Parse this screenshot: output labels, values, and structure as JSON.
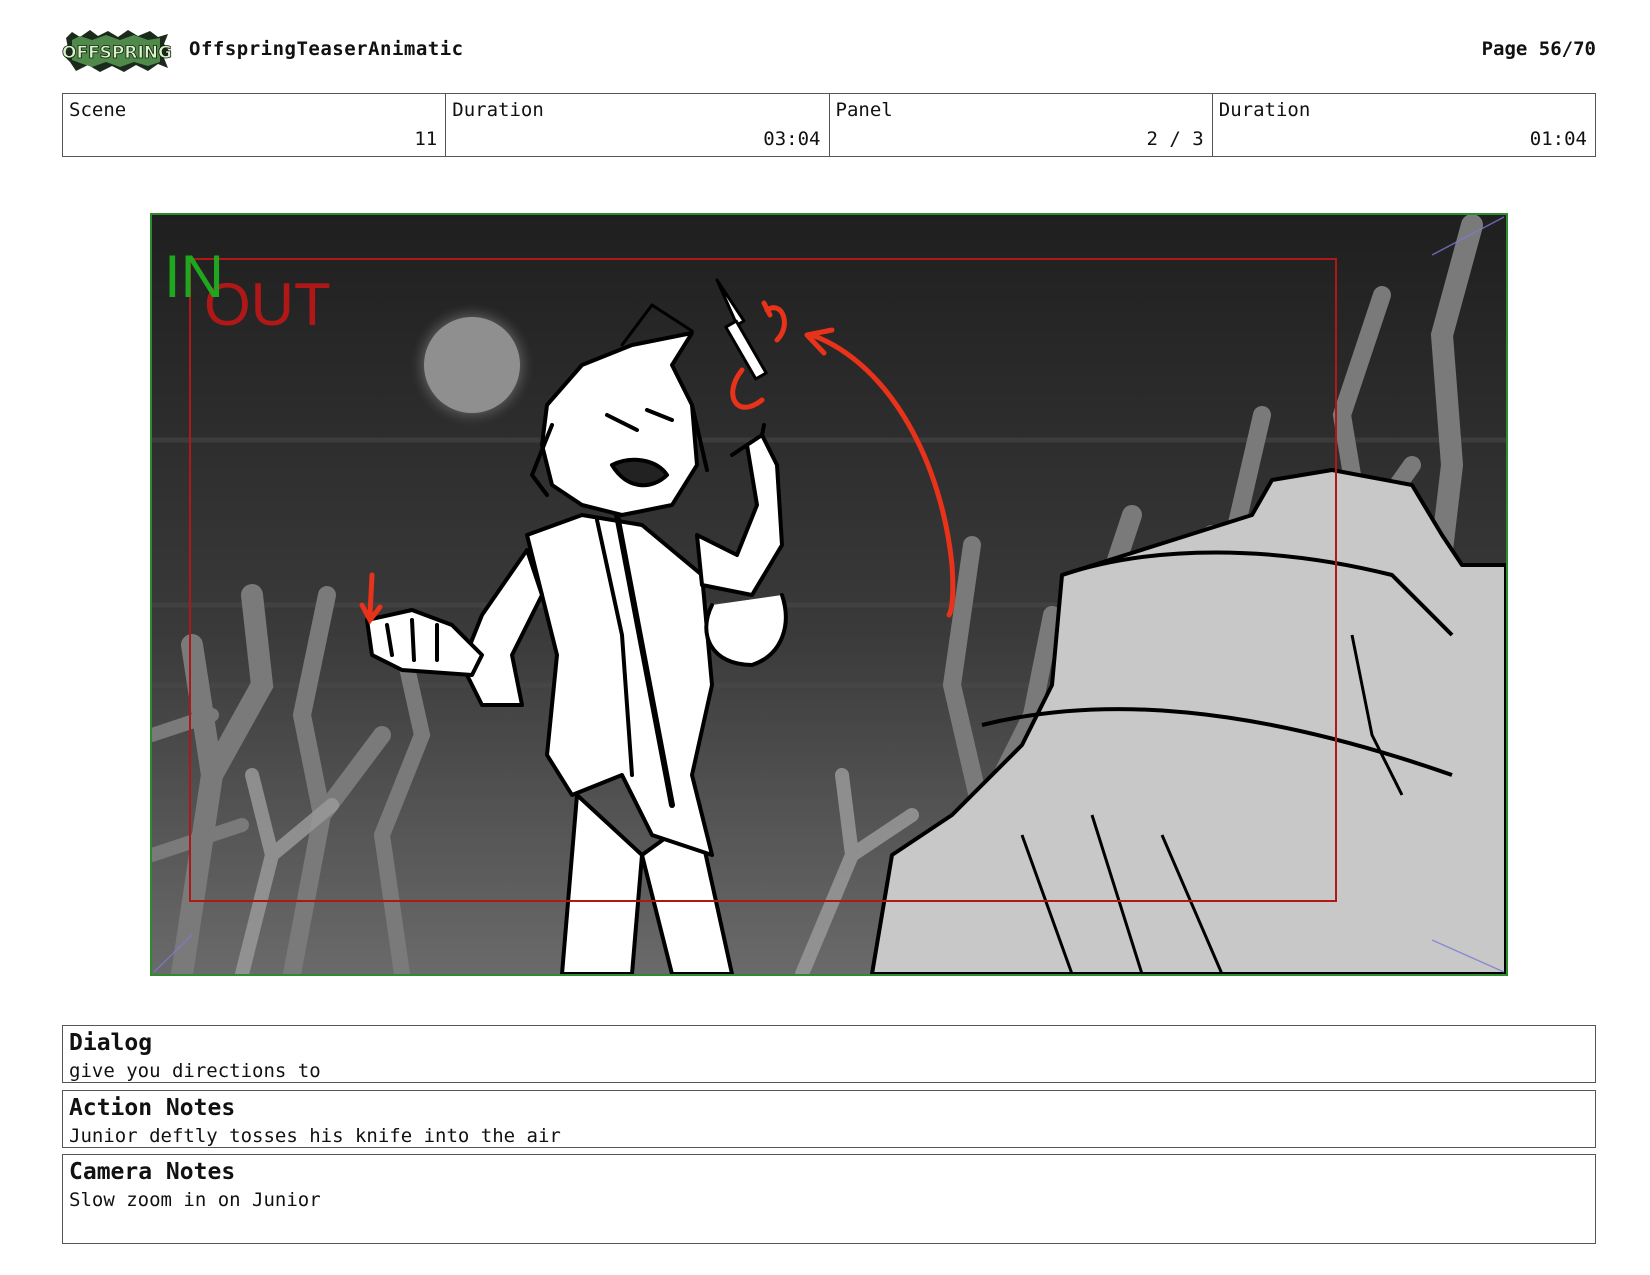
{
  "header": {
    "logo_text": "OFFSPRING",
    "project_title": "OffspringTeaserAnimatic",
    "page": "Page 56/70"
  },
  "info": [
    {
      "label": "Scene",
      "value": "11"
    },
    {
      "label": "Duration",
      "value": "03:04"
    },
    {
      "label": "Panel",
      "value": "2 / 3"
    },
    {
      "label": "Duration",
      "value": "01:04"
    }
  ],
  "panel": {
    "in_label": "IN",
    "out_label": "OUT"
  },
  "notes": {
    "dialog": {
      "title": "Dialog",
      "text": "give you directions to"
    },
    "action": {
      "title": "Action Notes",
      "text": "Junior deftly tosses his knife into the air"
    },
    "camera": {
      "title": "Camera Notes",
      "text": "Slow zoom in on Junior"
    }
  },
  "colors": {
    "in_frame": "#2e8b2e",
    "out_frame": "#b01818",
    "annotation": "#e8321a"
  }
}
